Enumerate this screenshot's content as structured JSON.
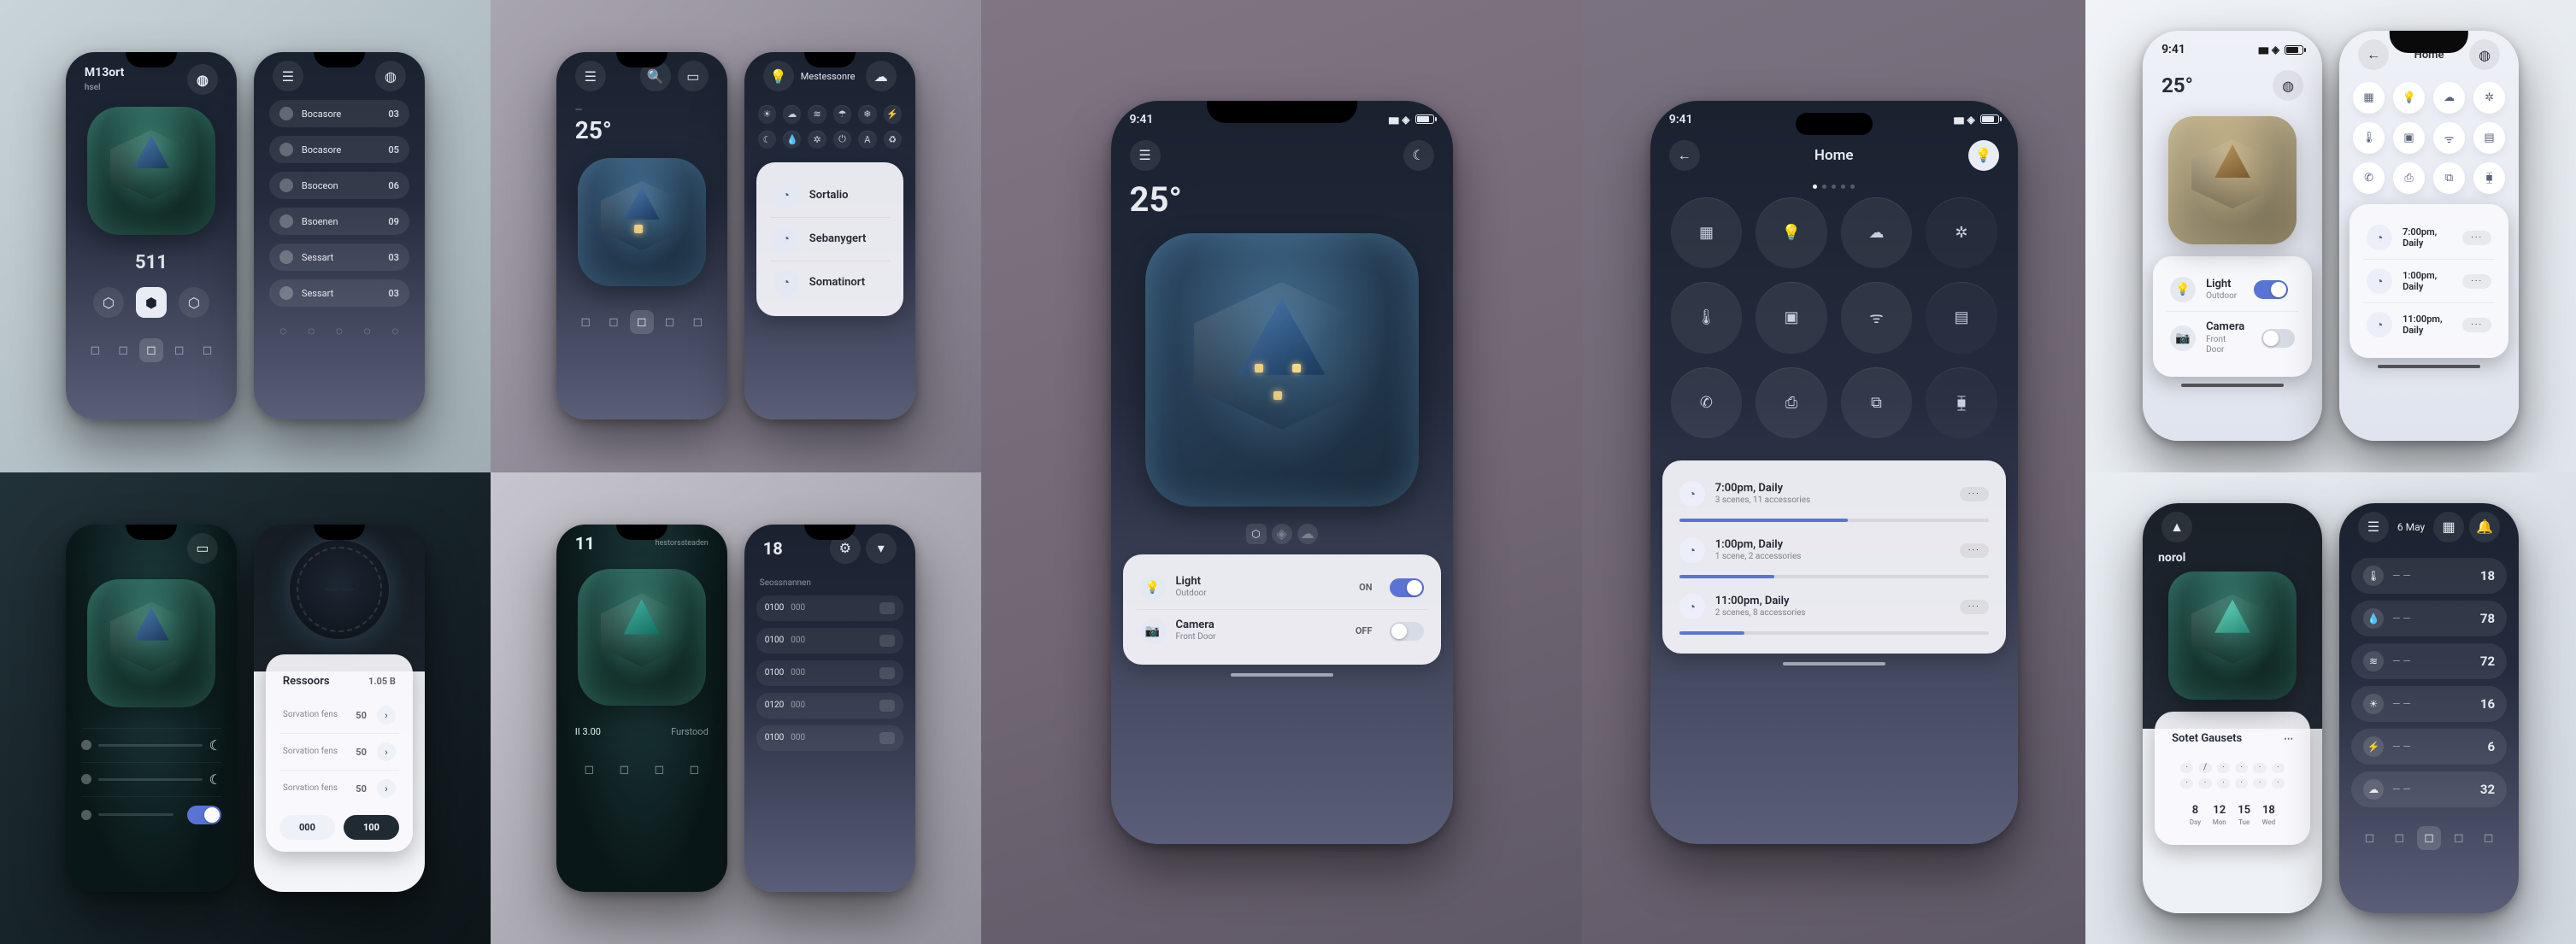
{
  "statusbar": {
    "time": "9:41"
  },
  "panel1": {
    "topLeft": {
      "title": "M13ort",
      "subtitle": "hsel",
      "metric": "511"
    },
    "topRight": {
      "items": [
        {
          "label": "Bocasore",
          "val": "03"
        },
        {
          "label": "Bocasore",
          "val": "05"
        },
        {
          "label": "Bsoceon",
          "val": "06"
        },
        {
          "label": "Bsoenen",
          "val": "09"
        },
        {
          "label": "Sessart",
          "val": "03"
        },
        {
          "label": "Sessart",
          "val": "03"
        }
      ]
    },
    "bottomLeft": {
      "metric": ""
    },
    "bottomRight": {
      "section": "Ressoors",
      "value": "1.05 B",
      "rows": [
        {
          "label": "Sorvation fens",
          "val": "50"
        },
        {
          "label": "Sorvation fens",
          "val": "50"
        },
        {
          "label": "Sorvation fens",
          "val": "50"
        }
      ],
      "ctaPrimary": "100",
      "ctaSecondary": "000"
    }
  },
  "panel2": {
    "topLeft": {
      "temp": "25°",
      "sub": "—"
    },
    "topRight": {
      "header": "Mestessonre",
      "miniIcons": [
        "sun",
        "cloud",
        "wind",
        "rain",
        "snow",
        "bolt",
        "moon",
        "drop",
        "fan",
        "plug",
        "auto",
        "eco"
      ],
      "card": [
        {
          "label": "Sortalio",
          "sub": ""
        },
        {
          "label": "Sebanygert",
          "sub": ""
        },
        {
          "label": "Somatinort",
          "sub": ""
        }
      ]
    },
    "bottomLeft": {
      "num": "11",
      "sub": "hestorssteaden",
      "footerA": "II 3.00",
      "footerB": "Furstood"
    },
    "bottomRight": {
      "num": "18",
      "sub": "Seossnannen",
      "rows": [
        {
          "t": "0100",
          "s": "000"
        },
        {
          "t": "0100",
          "s": "000"
        },
        {
          "t": "0100",
          "s": "000"
        },
        {
          "t": "0120",
          "s": "000"
        },
        {
          "t": "0100",
          "s": "000"
        }
      ]
    }
  },
  "center": {
    "left": {
      "temp": "25°",
      "devices": [
        {
          "icon": "bulb",
          "title": "Light",
          "subtitle": "Outdoor",
          "state": "ON",
          "on": true
        },
        {
          "icon": "camera",
          "title": "Camera",
          "subtitle": "Front Door",
          "state": "OFF",
          "on": false
        }
      ]
    },
    "right": {
      "title": "Home",
      "grid": [
        "grid",
        "bulb",
        "weather",
        "fan",
        "thermo",
        "play",
        "wifi",
        "panel",
        "phone",
        "print",
        "copy",
        "video"
      ],
      "schedules": [
        {
          "time": "7:00pm, Daily",
          "detail": "3 scenes, 11 accessories"
        },
        {
          "time": "1:00pm, Daily",
          "detail": "1 scene, 2 accessories"
        },
        {
          "time": "11:00pm, Daily",
          "detail": "2 scenes, 8 accessories"
        }
      ]
    }
  },
  "panel4": {
    "topLeft": {
      "temp": "25°",
      "devices": [
        {
          "icon": "bulb",
          "title": "Light",
          "subtitle": "Outdoor",
          "on": true
        },
        {
          "icon": "camera",
          "title": "Camera",
          "subtitle": "Front Door",
          "on": false
        }
      ]
    },
    "topRight": {
      "title": "Home",
      "grid": [
        "grid",
        "bulb",
        "weather",
        "fan",
        "thermo",
        "play",
        "wifi",
        "panel",
        "phone",
        "print",
        "copy",
        "video"
      ],
      "schedules": [
        {
          "time": "7:00pm, Daily",
          "detail": "—"
        },
        {
          "time": "1:00pm, Daily",
          "detail": "—"
        },
        {
          "time": "11:00pm, Daily",
          "detail": "—"
        }
      ]
    },
    "bottomLeft": {
      "brand": "norol",
      "cardTitle": "Sotet Gausets",
      "numbers": [
        {
          "n": "8",
          "s": "Day"
        },
        {
          "n": "12",
          "s": "Mon"
        },
        {
          "n": "15",
          "s": "Tue"
        },
        {
          "n": "18",
          "s": "Wed"
        }
      ]
    },
    "bottomRight": {
      "date": "6 May",
      "stats": [
        {
          "icon": "thermo",
          "label": "— —",
          "val": "18"
        },
        {
          "icon": "drop",
          "label": "— —",
          "val": "78"
        },
        {
          "icon": "wind",
          "label": "— —",
          "val": "72"
        },
        {
          "icon": "sun",
          "label": "— —",
          "val": "16"
        },
        {
          "icon": "bolt",
          "label": "— —",
          "val": "6"
        },
        {
          "icon": "cloud",
          "label": "— —",
          "val": "32"
        }
      ]
    }
  },
  "glyph": {
    "menu": "☰",
    "moon": "☾",
    "back": "←",
    "bulb": "💡",
    "camera": "📷",
    "clock": "◔",
    "grid": "▦",
    "weather": "☁",
    "fan": "✲",
    "thermo": "🌡",
    "play": "▣",
    "wifi": "ᯤ",
    "panel": "▤",
    "phone": "✆",
    "print": "⎙",
    "copy": "⧉",
    "video": "⧯",
    "sun": "☀",
    "cloud": "☁",
    "wind": "≋",
    "rain": "☂",
    "snow": "❄",
    "bolt": "⚡",
    "drop": "💧",
    "plug": "⏻",
    "auto": "A",
    "eco": "♻",
    "gear": "⚙",
    "plus": "＋",
    "bell": "🔔",
    "user": "👤",
    "search": "🔍",
    "chev": "▾"
  }
}
